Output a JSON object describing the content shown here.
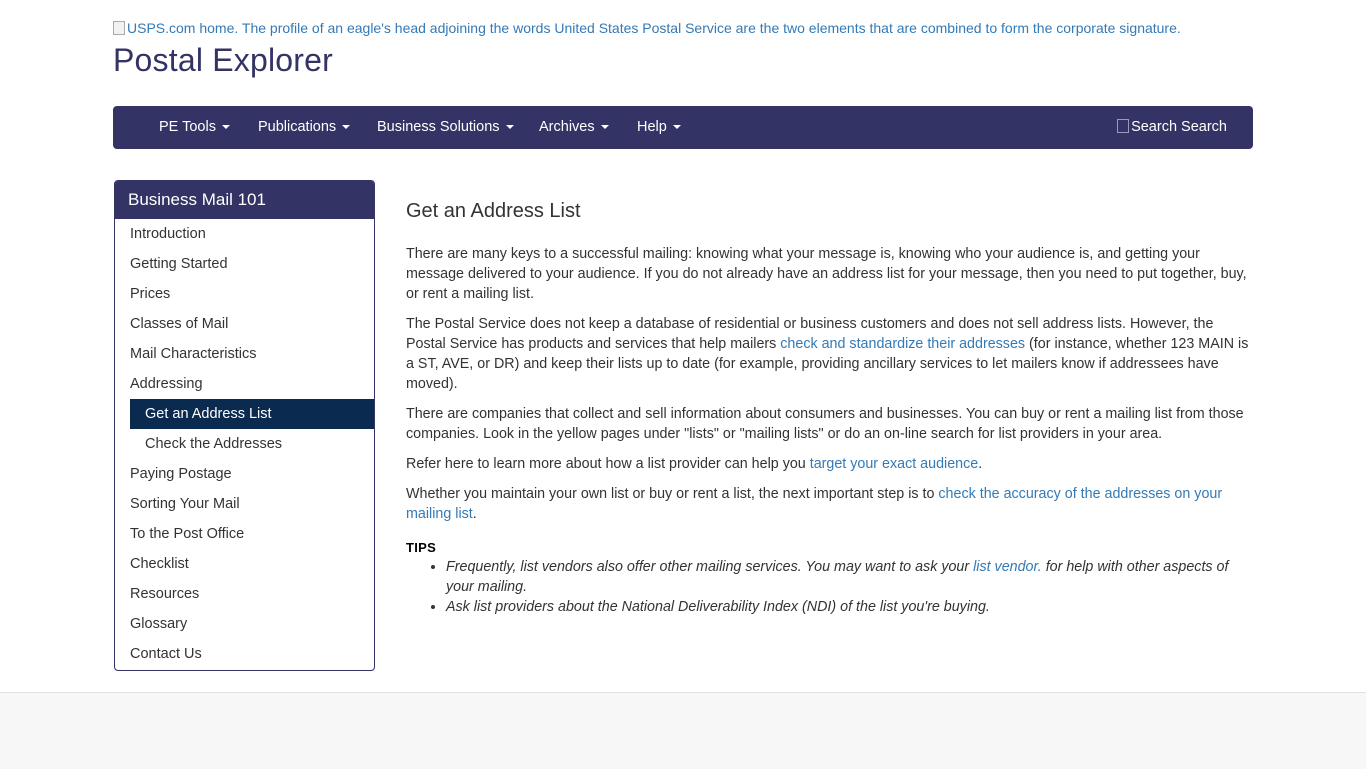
{
  "header": {
    "logo_alt": "USPS.com home. The profile of an eagle's head adjoining the words United States Postal Service are the two elements that are combined to form the corporate signature.",
    "site_title": "Postal Explorer"
  },
  "nav": {
    "items": [
      {
        "label": "PE Tools"
      },
      {
        "label": "Publications"
      },
      {
        "label": "Business Solutions"
      },
      {
        "label": "Archives"
      },
      {
        "label": "Help"
      }
    ],
    "search_alt": "Search",
    "search_label": "Search"
  },
  "sidebar": {
    "title": "Business Mail 101",
    "items": [
      {
        "label": "Introduction"
      },
      {
        "label": "Getting Started"
      },
      {
        "label": "Prices"
      },
      {
        "label": "Classes of Mail"
      },
      {
        "label": "Mail Characteristics"
      },
      {
        "label": "Addressing"
      },
      {
        "label": "Get an Address List",
        "active": true
      },
      {
        "label": "Check the Addresses"
      },
      {
        "label": "Paying Postage"
      },
      {
        "label": "Sorting Your Mail"
      },
      {
        "label": "To the Post Office"
      },
      {
        "label": "Checklist"
      },
      {
        "label": "Resources"
      },
      {
        "label": "Glossary"
      },
      {
        "label": "Contact Us"
      }
    ]
  },
  "main": {
    "title": "Get an Address List",
    "p1": "There are many keys to a successful mailing: knowing what your message is, knowing who your audience is, and getting your message delivered to your audience. If you do not already have an address list for your message, then you need to put together, buy, or rent a mailing list.",
    "p2_a": "The Postal Service does not keep a database of residential or business customers and does not sell address lists. However, the Postal Service has products and services that help mailers ",
    "p2_link": "check and standardize their addresses",
    "p2_b": " (for instance, whether 123 MAIN is a ST, AVE, or DR) and keep their lists up to date (for example, providing ancillary services to let mailers know if addressees have moved).",
    "p3": "There are companies that collect and sell information about consumers and businesses. You can buy or rent a mailing list from those companies. Look in the yellow pages under \"lists\" or \"mailing lists\" or do an on-line search for list providers in your area.",
    "p4_a": "Refer here to learn more about how a list provider can help you ",
    "p4_link": "target your exact audience",
    "p4_b": ".",
    "p5_a": "Whether you maintain your own list or buy or rent a list, the next important step is to ",
    "p5_link": "check the accuracy of the addresses on your mailing list",
    "p5_b": ".",
    "tips_title": "TIPS",
    "tip1_a": "Frequently, list vendors also offer other mailing services. You may want to ask your ",
    "tip1_link": "list vendor.",
    "tip1_b": " for help with other aspects of your mailing.",
    "tip2": "Ask list providers about the National Deliverability Index (NDI) of the list you're buying."
  },
  "colors": {
    "brand": "#333366",
    "active": "#0b2a50",
    "link": "#337ab7"
  }
}
